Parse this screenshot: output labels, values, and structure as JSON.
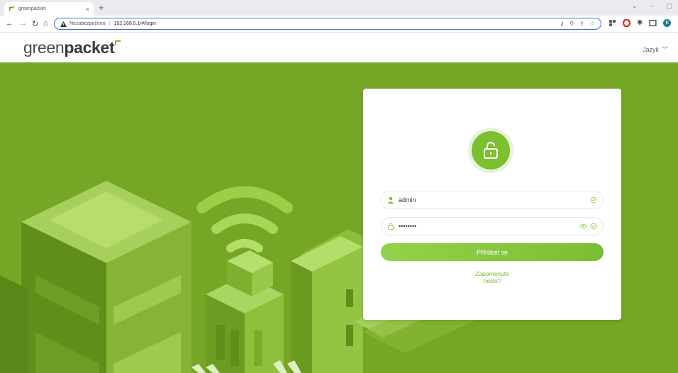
{
  "browser": {
    "tab_title": "greenpacket",
    "address_warning": "Nezabezpečeno",
    "url": "192.168.0.1/#/login",
    "new_tab": "+",
    "tab_close": "×",
    "ext_avatar_initial": "K"
  },
  "header": {
    "logo_light": "green",
    "logo_bold": "packet",
    "language_label": "Jazyk"
  },
  "login": {
    "username_value": "admin",
    "password_value": "••••••••",
    "submit_label": "Přihlásit se",
    "forgot_line1": "Zapomenuté",
    "forgot_line2": "heslo?"
  },
  "colors": {
    "brand_green": "#7cbf2f",
    "hero_bg": "#76a625",
    "link_green": "#7cb432"
  }
}
